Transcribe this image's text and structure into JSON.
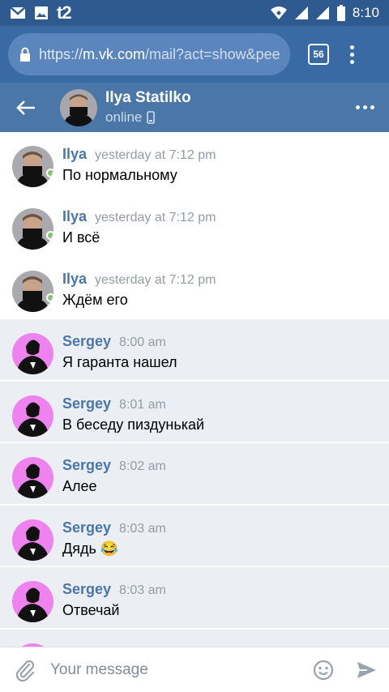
{
  "statusbar": {
    "carrier": "t2",
    "time": "8:10",
    "icons": [
      "gmail-icon",
      "image-icon",
      "data-transfer-icon",
      "wifi-icon",
      "signal-icon",
      "battery-icon"
    ]
  },
  "browser": {
    "url_scheme": "https://",
    "url_host": "m.vk.com",
    "url_path": "/mail?act=show&pee",
    "tab_count": "56"
  },
  "header": {
    "name": "Ilya Statilko",
    "status": "online"
  },
  "messages": [
    {
      "author": "Ilya",
      "time": "yesterday at 7:12 pm",
      "text": "По нормальному",
      "kind": "in"
    },
    {
      "author": "Ilya",
      "time": "yesterday at 7:12 pm",
      "text": "И всё",
      "kind": "in"
    },
    {
      "author": "Ilya",
      "time": "yesterday at 7:12 pm",
      "text": "Ждём его",
      "kind": "in"
    },
    {
      "author": "Sergey",
      "time": "8:00 am",
      "text": "Я гаранта нашел",
      "kind": "out"
    },
    {
      "author": "Sergey",
      "time": "8:01 am",
      "text": "В беседу пиздунькай",
      "kind": "out"
    },
    {
      "author": "Sergey",
      "time": "8:02 am",
      "text": "Алее",
      "kind": "out"
    },
    {
      "author": "Sergey",
      "time": "8:03 am",
      "text": "Дядь 😂",
      "kind": "out"
    },
    {
      "author": "Sergey",
      "time": "8:03 am",
      "text": "Отвечай",
      "kind": "out"
    },
    {
      "author": "",
      "time": "",
      "text": "",
      "kind": "out"
    }
  ],
  "composer": {
    "placeholder": "Your message"
  },
  "colors": {
    "vk_header": "#4a76a8",
    "url_bar": "#3a6aa3",
    "status_bar": "#2f5a8f",
    "outgoing_bg": "#ebeef3",
    "author": "#4a76a8",
    "sergey_avatar_bg": "#ee82ee"
  }
}
